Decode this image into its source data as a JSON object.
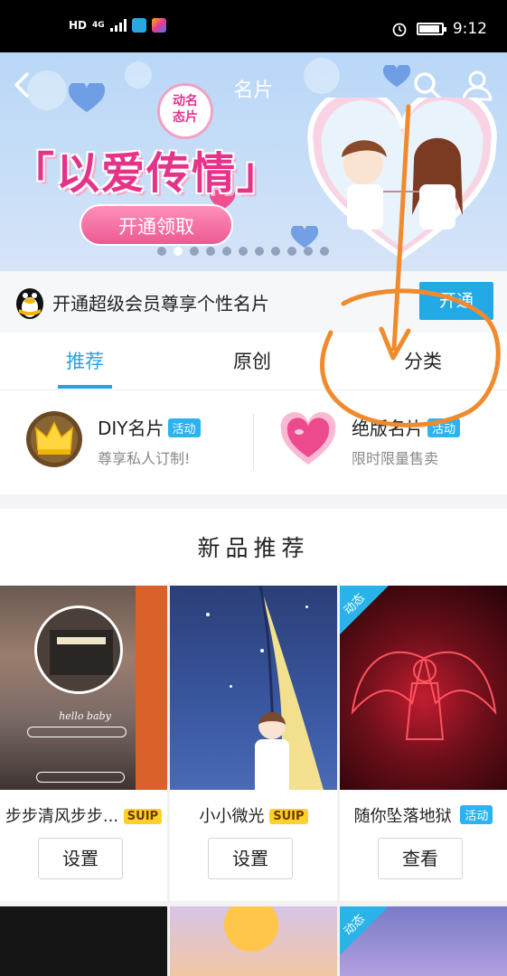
{
  "status_bar": {
    "network_label": "HD",
    "network_gen": "4G",
    "time": "9:12"
  },
  "banner": {
    "nav_title": "名片",
    "badge_line1": "动名",
    "badge_line2": "态片",
    "promo_title": "「以爱传情」",
    "promo_button": "开通领取",
    "page_count": 11,
    "active_page_index": 1
  },
  "vip_strip": {
    "text": "开通超级会员尊享个性名片",
    "button": "开通"
  },
  "tabs": [
    {
      "label": "推荐",
      "active": true
    },
    {
      "label": "原创",
      "active": false
    },
    {
      "label": "分类",
      "active": false
    }
  ],
  "features": [
    {
      "title": "DIY名片",
      "tag": "活动",
      "subtitle": "尊享私人订制!"
    },
    {
      "title": "绝版名片",
      "tag": "活动",
      "subtitle": "限时限量售卖"
    }
  ],
  "section": {
    "title": "新品推荐"
  },
  "cards": [
    {
      "name": "步步清风步步...",
      "badge": "SUIP",
      "button": "设置",
      "dynamic": false,
      "img_text": "hello baby"
    },
    {
      "name": "小小微光",
      "badge": "SUIP",
      "button": "设置",
      "dynamic": false
    },
    {
      "name": "随你坠落地狱",
      "badge": "活动",
      "button": "查看",
      "dynamic": true,
      "dynamic_label": "动态"
    }
  ],
  "row2_dynamic_label": "动态",
  "colors": {
    "accent_blue": "#2aa0e0",
    "vip_button": "#22a9e6",
    "promo_pink": "#e6338a",
    "suip_yellow": "#ffd02c",
    "annotation_orange": "#f08a2c"
  },
  "icons": [
    "back-icon",
    "search-icon",
    "user-icon",
    "penguin-icon",
    "crown-icon",
    "heart-icon"
  ]
}
